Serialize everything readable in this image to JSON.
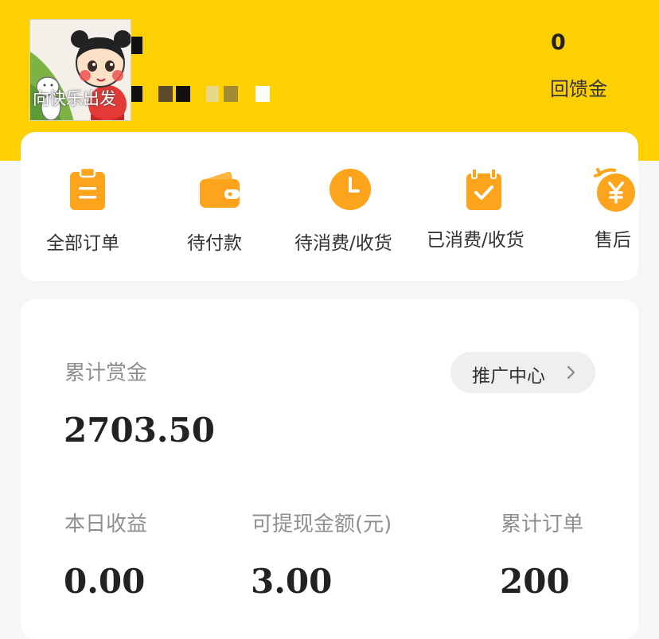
{
  "profile": {
    "avatar_caption": "向快乐出发"
  },
  "feedback": {
    "value": "0",
    "label": "回馈金"
  },
  "orders": {
    "items": [
      {
        "label": "全部订单",
        "icon": "clipboard-icon"
      },
      {
        "label": "待付款",
        "icon": "wallet-icon"
      },
      {
        "label": "待消费/收货",
        "icon": "clock-icon"
      },
      {
        "label": "已消费/收货",
        "icon": "check-clipboard-icon"
      },
      {
        "label": "售后",
        "icon": "yen-refund-icon"
      }
    ]
  },
  "earnings": {
    "total_label": "累计赏金",
    "total_value": "2703.50",
    "promo_button_label": "推广中心",
    "stats": [
      {
        "label": "本日收益",
        "value": "0.00"
      },
      {
        "label": "可提现金额(元)",
        "value": "3.00"
      },
      {
        "label": "累计订单",
        "value": "200"
      }
    ]
  },
  "colors": {
    "brand_yellow": "#fdd001",
    "icon_orange": "#fba41c"
  }
}
